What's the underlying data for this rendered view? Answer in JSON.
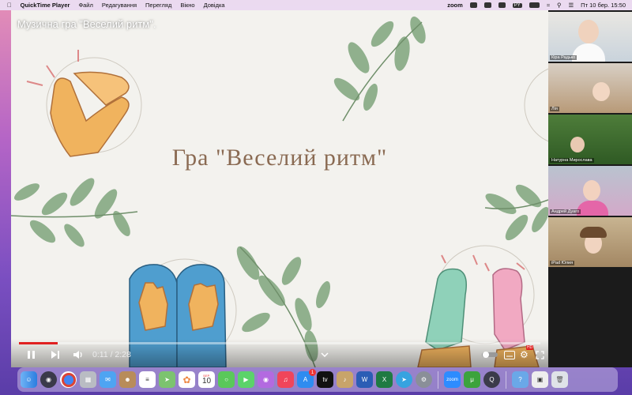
{
  "menubar": {
    "app_name": "QuickTime Player",
    "menus": [
      "Файл",
      "Редагування",
      "Перегляд",
      "Вікно",
      "Довідка"
    ],
    "zoom_label": "zoom",
    "input_lang": "PY",
    "datetime": "Пт 10 бер.  15:50"
  },
  "video": {
    "overlay_title": "Музична гра \"Веселий ритм\".",
    "slide_title": "Гра \"Веселий ритм\"",
    "time_display": "0:11 / 2:28",
    "progress_fraction": 0.074,
    "hd_label": "HD"
  },
  "participants": [
    {
      "name": "Кіра Радько"
    },
    {
      "name": "Лія"
    },
    {
      "name": "Натурна Мирослава"
    },
    {
      "name": "Андрей Дуаго"
    },
    {
      "name": "iPad Юлия"
    }
  ],
  "dock": {
    "calendar_month": "БЕР.",
    "calendar_day": "10",
    "appstore_badge": "1",
    "zoom_label": "zoom"
  },
  "colors": {
    "progress": "#e02020",
    "slide_title": "#8a6a52",
    "leaf": "#6f9a70"
  }
}
